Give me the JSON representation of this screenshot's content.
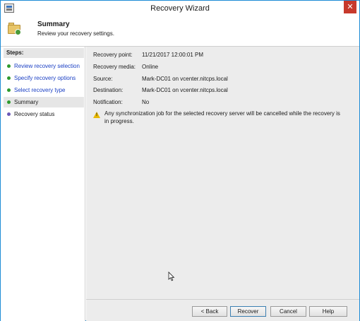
{
  "window": {
    "title": "Recovery Wizard",
    "close_glyph": "✕"
  },
  "header": {
    "title": "Summary",
    "subtitle": "Review your recovery settings."
  },
  "steps": {
    "heading": "Steps:",
    "items": [
      {
        "label": "Review recovery selection",
        "state": "done"
      },
      {
        "label": "Specify recovery options",
        "state": "done"
      },
      {
        "label": "Select recovery type",
        "state": "done"
      },
      {
        "label": "Summary",
        "state": "current"
      },
      {
        "label": "Recovery status",
        "state": "pending"
      }
    ]
  },
  "summary": {
    "rows": [
      {
        "label": "Recovery point:",
        "value": "11/21/2017 12:00:01 PM"
      },
      {
        "label": "Recovery media:",
        "value": "Online"
      },
      {
        "label": "Source:",
        "value": "Mark-DC01 on vcenter.nitcps.local"
      },
      {
        "label": "Destination:",
        "value": "Mark-DC01 on vcenter.nitcps.local"
      },
      {
        "label": "Notification:",
        "value": "No"
      }
    ],
    "warning": "Any synchronization job for the selected recovery server will be cancelled while the recovery is in progress."
  },
  "buttons": {
    "back": "< Back",
    "recover": "Recover",
    "cancel": "Cancel",
    "help": "Help"
  },
  "colors": {
    "link": "#1a3fc4",
    "done_dot": "#2e9a2e",
    "pending_dot": "#6a58b8",
    "close": "#c7392c",
    "warning": "#e8b800"
  },
  "icons": {
    "app": "recovery-wizard-icon",
    "header": "folder-summary-icon",
    "warning": "warning-icon",
    "close": "close-icon"
  }
}
